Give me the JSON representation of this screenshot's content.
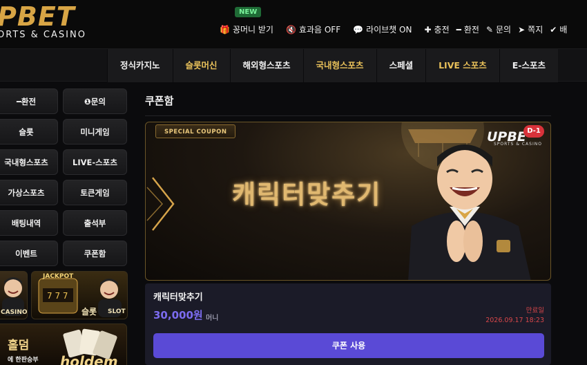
{
  "header": {
    "logo_main": "PBET",
    "logo_sub": "ORTS & CASINO",
    "new_badge": "NEW",
    "menu": [
      {
        "icon": "gift-icon",
        "label": "꽁머니 받기"
      },
      {
        "icon": "speaker-mute-icon",
        "label": "효과음 OFF"
      },
      {
        "icon": "chat-icon",
        "label": "라이브챗 ON"
      },
      {
        "icon": "plus-icon",
        "label": "충전"
      },
      {
        "icon": "minus-icon",
        "label": "환전"
      },
      {
        "icon": "edit-icon",
        "label": "문의"
      },
      {
        "icon": "paper-plane-icon",
        "label": "쪽지"
      },
      {
        "icon": "check-icon",
        "label": "배"
      }
    ]
  },
  "nav": {
    "items": [
      {
        "label": "정식카지노",
        "color": "#f0f0f0"
      },
      {
        "label": "슬롯머신",
        "color": "#e9c15a"
      },
      {
        "label": "해외형스포츠",
        "color": "#f0f0f0"
      },
      {
        "label": "국내형스포츠",
        "color": "#e9c15a"
      },
      {
        "label": "스페셜",
        "color": "#f0f0f0"
      },
      {
        "label": "LIVE 스포츠",
        "color": "#e9c15a"
      },
      {
        "label": "E-스포츠",
        "color": "#f0f0f0"
      }
    ]
  },
  "sidebar": {
    "buttons": [
      {
        "label": "환전",
        "icon": "minus-icon"
      },
      {
        "label": "문의",
        "icon": "info-icon"
      },
      {
        "label": "슬롯"
      },
      {
        "label": "미니게임"
      },
      {
        "label": "국내형스포츠"
      },
      {
        "label": "LIVE-스포츠"
      },
      {
        "label": "가상스포츠"
      },
      {
        "label": "토큰게임"
      },
      {
        "label": "배팅내역"
      },
      {
        "label": "출석부"
      },
      {
        "label": "이벤트"
      },
      {
        "label": "쿠폰함"
      }
    ],
    "promos": [
      {
        "label": "CASINO"
      },
      {
        "label_top": "JACKPOT",
        "label": "슬롯",
        "label_right": "SLOT"
      },
      {
        "label": "홀덤",
        "label_sub": "에 한판승부",
        "label_art": "holdem"
      }
    ]
  },
  "main": {
    "title": "쿠폰함",
    "banner": {
      "tag": "SPECIAL COUPON",
      "text": "캐릭터맞추기",
      "logo": "UPBE",
      "logo_sub": "SPORTS & CASINO",
      "badge": "D-1"
    },
    "coupon": {
      "name": "캐릭터맞추기",
      "amount": "30,000원",
      "unit": "머니",
      "expire_label": "만료일",
      "expire_date": "2026.09.17 18:23",
      "use_button": "쿠폰 사용"
    }
  },
  "colors": {
    "accent_gold": "#d8a545",
    "button_purple": "#5a4ad6",
    "amount_purple": "#7c6cf0",
    "expire_red": "#d9474a"
  }
}
